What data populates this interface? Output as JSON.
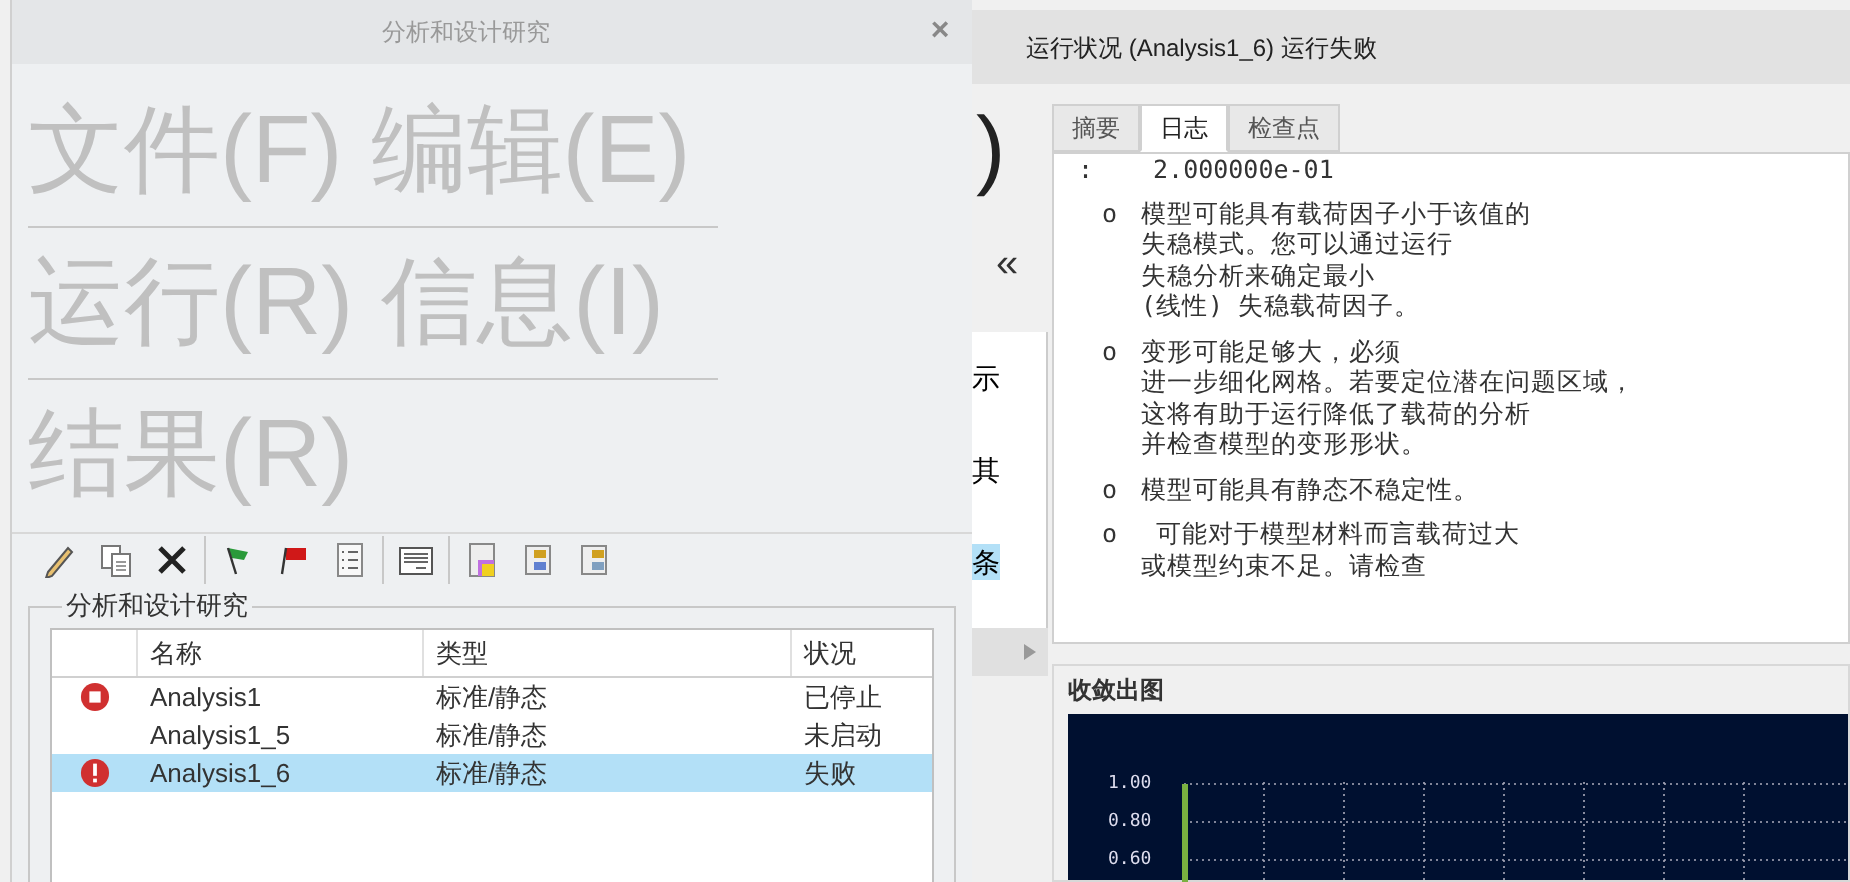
{
  "dialog": {
    "title": "分析和设计研究",
    "close": "×",
    "menu_rows": [
      [
        "文件(F)",
        "编辑(E)"
      ],
      [
        "运行(R)",
        "信息(I)"
      ],
      [
        "结果(R)"
      ]
    ],
    "toolbar": [
      {
        "kind": "pencil"
      },
      {
        "kind": "copy"
      },
      {
        "kind": "delete"
      },
      {
        "kind": "separator"
      },
      {
        "kind": "green-flag"
      },
      {
        "kind": "red-flag"
      },
      {
        "kind": "checklist"
      },
      {
        "kind": "separator"
      },
      {
        "kind": "listbox"
      },
      {
        "kind": "separator"
      },
      {
        "kind": "chart-a"
      },
      {
        "kind": "chart-b"
      },
      {
        "kind": "chart-c"
      }
    ],
    "group_title": "分析和设计研究",
    "table": {
      "columns": [
        "名称",
        "类型",
        "状况"
      ],
      "rows": [
        {
          "kind": "stopped",
          "name": "Analysis1",
          "type": "标准/静态",
          "status": "已停止",
          "selected": false
        },
        {
          "kind": "idle",
          "name": "Analysis1_5",
          "type": "标准/静态",
          "status": "未启动",
          "selected": false
        },
        {
          "kind": "failed",
          "name": "Analysis1_6",
          "type": "标准/静态",
          "status": "失败",
          "selected": true
        }
      ]
    }
  },
  "background_window": {
    "bracket": ")",
    "collapse": "«",
    "lines": [
      {
        "text": "示",
        "selected": false
      },
      {
        "text": "其",
        "selected": false
      },
      {
        "text": "条",
        "selected": true
      }
    ]
  },
  "run_window": {
    "title": "运行状况 (Analysis1_6) 运行失败",
    "tabs": [
      {
        "label": "摘要",
        "selected": false
      },
      {
        "label": "日志",
        "selected": true
      },
      {
        "label": "检查点",
        "selected": false
      }
    ],
    "log": [
      {
        "kind": "value",
        "label": ":",
        "value": "2.000000e-01"
      },
      {
        "kind": "bullet",
        "bullet": "o",
        "lines": [
          "模型可能具有载荷因子小于该值的",
          "失稳模式。您可以通过运行",
          "失稳分析来确定最小",
          "(线性) 失稳载荷因子。"
        ]
      },
      {
        "kind": "bullet",
        "bullet": "o",
        "lines": [
          "变形可能足够大，必须",
          "进一步细化网格。若要定位潜在问题区域，",
          "这将有助于运行降低了载荷的分析",
          "并检查模型的变形形状。"
        ]
      },
      {
        "kind": "bullet",
        "bullet": "o",
        "lines": [
          "模型可能具有静态不稳定性。"
        ]
      },
      {
        "kind": "bullet",
        "bullet": "o",
        "lines": [
          " 可能对于模型材料而言载荷过大",
          "或模型约束不足。请检查"
        ]
      }
    ],
    "chart": {
      "title": "收敛出图",
      "y_tick_labels": [
        "1.00",
        "0.80",
        "0.60"
      ]
    }
  }
}
